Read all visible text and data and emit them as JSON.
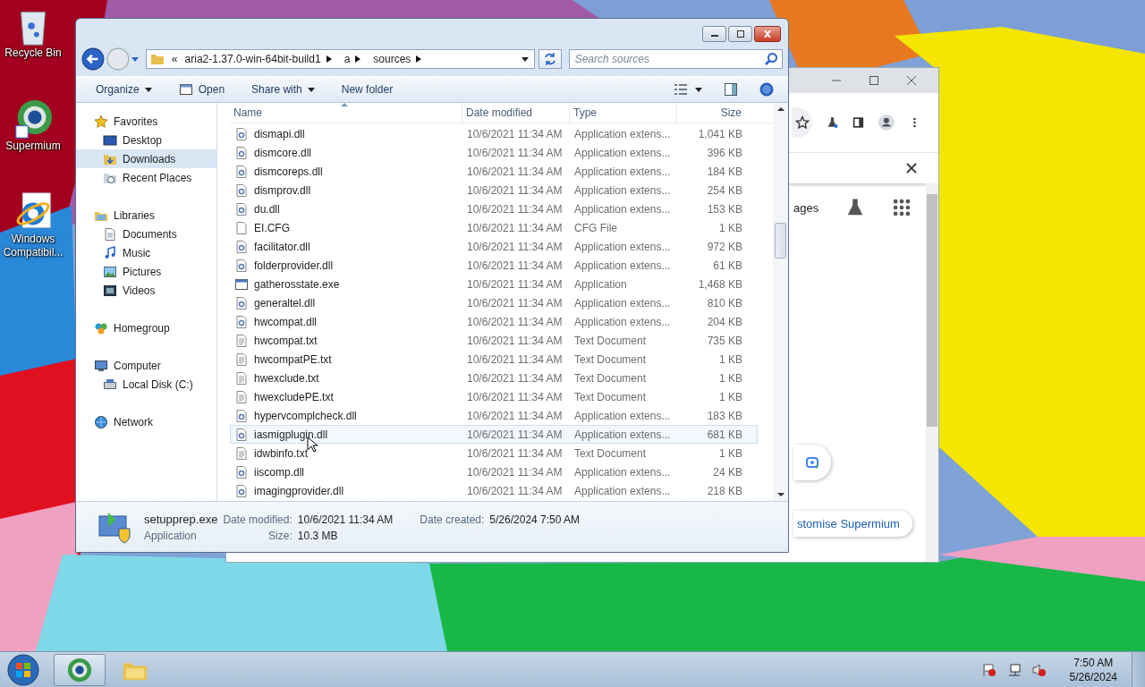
{
  "desktop_icons": [
    {
      "label": "Recycle Bin",
      "kind": "recycle"
    },
    {
      "label": "Supermium",
      "kind": "browser"
    },
    {
      "label": "Windows Compatibil...",
      "kind": "ie"
    }
  ],
  "browser_window": {
    "images_link": "ages",
    "customise_button": "stomise Supermium"
  },
  "explorer": {
    "breadcrumb_prefix": "«",
    "breadcrumb": [
      "aria2-1.37.0-win-64bit-build1",
      "a",
      "sources"
    ],
    "search": {
      "placeholder": "Search sources"
    },
    "toolbar": [
      {
        "label": "Organize",
        "kind": "menu"
      },
      {
        "label": "Open",
        "kind": "open"
      },
      {
        "label": "Share with",
        "kind": "menu"
      },
      {
        "label": "New folder",
        "kind": "plain"
      }
    ],
    "nav": [
      {
        "label": "Favorites",
        "kind": "star",
        "selected": false,
        "children": [
          {
            "label": "Desktop",
            "kind": "desktop",
            "selected": false
          },
          {
            "label": "Downloads",
            "kind": "download",
            "selected": true
          },
          {
            "label": "Recent Places",
            "kind": "recent",
            "selected": false
          }
        ]
      },
      {
        "label": "Libraries",
        "kind": "library",
        "selected": false,
        "children": [
          {
            "label": "Documents",
            "kind": "document",
            "selected": false
          },
          {
            "label": "Music",
            "kind": "music",
            "selected": false
          },
          {
            "label": "Pictures",
            "kind": "picture",
            "selected": false
          },
          {
            "label": "Videos",
            "kind": "video",
            "selected": false
          }
        ]
      },
      {
        "label": "Homegroup",
        "kind": "homegroup",
        "selected": false
      },
      {
        "label": "Computer",
        "kind": "computer",
        "selected": false,
        "children": [
          {
            "label": "Local Disk (C:)",
            "kind": "disk",
            "selected": false
          }
        ]
      },
      {
        "label": "Network",
        "kind": "network",
        "selected": false
      }
    ],
    "columns": [
      "Name",
      "Date modified",
      "Type",
      "Size"
    ],
    "files": [
      {
        "name": "dismapi.dll",
        "modified": "10/6/2021 11:34 AM",
        "type": "Application extens...",
        "size": "1,041 KB",
        "kind": "dll",
        "hovered": false
      },
      {
        "name": "dismcore.dll",
        "modified": "10/6/2021 11:34 AM",
        "type": "Application extens...",
        "size": "396 KB",
        "kind": "dll",
        "hovered": false
      },
      {
        "name": "dismcoreps.dll",
        "modified": "10/6/2021 11:34 AM",
        "type": "Application extens...",
        "size": "184 KB",
        "kind": "dll",
        "hovered": false
      },
      {
        "name": "dismprov.dll",
        "modified": "10/6/2021 11:34 AM",
        "type": "Application extens...",
        "size": "254 KB",
        "kind": "dll",
        "hovered": false
      },
      {
        "name": "du.dll",
        "modified": "10/6/2021 11:34 AM",
        "type": "Application extens...",
        "size": "153 KB",
        "kind": "dll",
        "hovered": false
      },
      {
        "name": "EI.CFG",
        "modified": "10/6/2021 11:34 AM",
        "type": "CFG File",
        "size": "1 KB",
        "kind": "file",
        "hovered": false
      },
      {
        "name": "facilitator.dll",
        "modified": "10/6/2021 11:34 AM",
        "type": "Application extens...",
        "size": "972 KB",
        "kind": "dll",
        "hovered": false
      },
      {
        "name": "folderprovider.dll",
        "modified": "10/6/2021 11:34 AM",
        "type": "Application extens...",
        "size": "61 KB",
        "kind": "dll",
        "hovered": false
      },
      {
        "name": "gatherosstate.exe",
        "modified": "10/6/2021 11:34 AM",
        "type": "Application",
        "size": "1,468 KB",
        "kind": "exe",
        "hovered": false
      },
      {
        "name": "generaltel.dll",
        "modified": "10/6/2021 11:34 AM",
        "type": "Application extens...",
        "size": "810 KB",
        "kind": "dll",
        "hovered": false
      },
      {
        "name": "hwcompat.dll",
        "modified": "10/6/2021 11:34 AM",
        "type": "Application extens...",
        "size": "204 KB",
        "kind": "dll",
        "hovered": false
      },
      {
        "name": "hwcompat.txt",
        "modified": "10/6/2021 11:34 AM",
        "type": "Text Document",
        "size": "735 KB",
        "kind": "txt",
        "hovered": false
      },
      {
        "name": "hwcompatPE.txt",
        "modified": "10/6/2021 11:34 AM",
        "type": "Text Document",
        "size": "1 KB",
        "kind": "txt",
        "hovered": false
      },
      {
        "name": "hwexclude.txt",
        "modified": "10/6/2021 11:34 AM",
        "type": "Text Document",
        "size": "1 KB",
        "kind": "txt",
        "hovered": false
      },
      {
        "name": "hwexcludePE.txt",
        "modified": "10/6/2021 11:34 AM",
        "type": "Text Document",
        "size": "1 KB",
        "kind": "txt",
        "hovered": false
      },
      {
        "name": "hypervcomplcheck.dll",
        "modified": "10/6/2021 11:34 AM",
        "type": "Application extens...",
        "size": "183 KB",
        "kind": "dll",
        "hovered": false
      },
      {
        "name": "iasmigplugin.dll",
        "modified": "10/6/2021 11:34 AM",
        "type": "Application extens...",
        "size": "681 KB",
        "kind": "dll",
        "hovered": true
      },
      {
        "name": "idwbinfo.txt",
        "modified": "10/6/2021 11:34 AM",
        "type": "Text Document",
        "size": "1 KB",
        "kind": "txt",
        "hovered": false
      },
      {
        "name": "iiscomp.dll",
        "modified": "10/6/2021 11:34 AM",
        "type": "Application extens...",
        "size": "24 KB",
        "kind": "dll",
        "hovered": false
      },
      {
        "name": "imagingprovider.dll",
        "modified": "10/6/2021 11:34 AM",
        "type": "Application extens...",
        "size": "218 KB",
        "kind": "dll",
        "hovered": false
      }
    ],
    "details": {
      "name": "setupprep.exe",
      "type": "Application",
      "fields": [
        {
          "label": "Date modified:",
          "value": "10/6/2021 11:34 AM"
        },
        {
          "label": "Size:",
          "value": "10.3 MB"
        },
        {
          "label": "Date created:",
          "value": "5/26/2024 7:50 AM"
        }
      ]
    }
  },
  "taskbar": {
    "time": "7:50 AM",
    "date": "5/26/2024"
  }
}
